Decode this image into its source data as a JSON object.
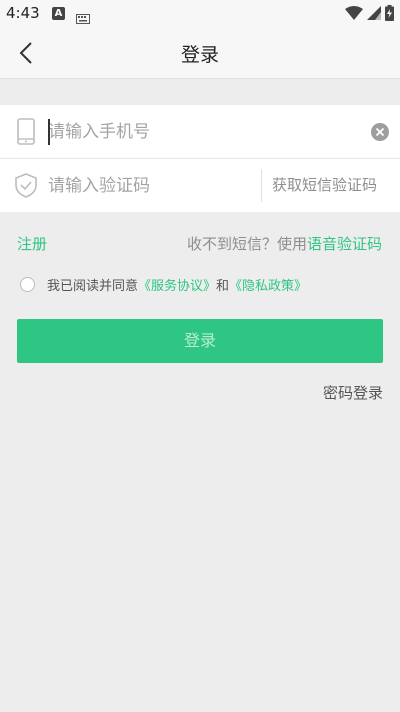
{
  "status_bar": {
    "time": "4:43",
    "a_badge": "A"
  },
  "header": {
    "title": "登录"
  },
  "form": {
    "phone_placeholder": "请输入手机号",
    "code_placeholder": "请输入验证码",
    "get_code_label": "获取短信验证码"
  },
  "links": {
    "register": "注册",
    "no_sms_text": "收不到短信？使用",
    "voice_code": "语音验证码"
  },
  "agreement": {
    "prefix": "我已阅读并同意",
    "service_agreement": "《服务协议》",
    "and": "和",
    "privacy_policy": "《隐私政策》"
  },
  "login_button": "登录",
  "password_login": "密码登录",
  "colors": {
    "accent": "#2ec682",
    "background": "#ededed"
  },
  "icons": [
    "back-icon",
    "phone-icon",
    "shield-icon",
    "clear-icon",
    "wifi-icon",
    "signal-icon",
    "battery-icon",
    "keyboard-icon"
  ]
}
